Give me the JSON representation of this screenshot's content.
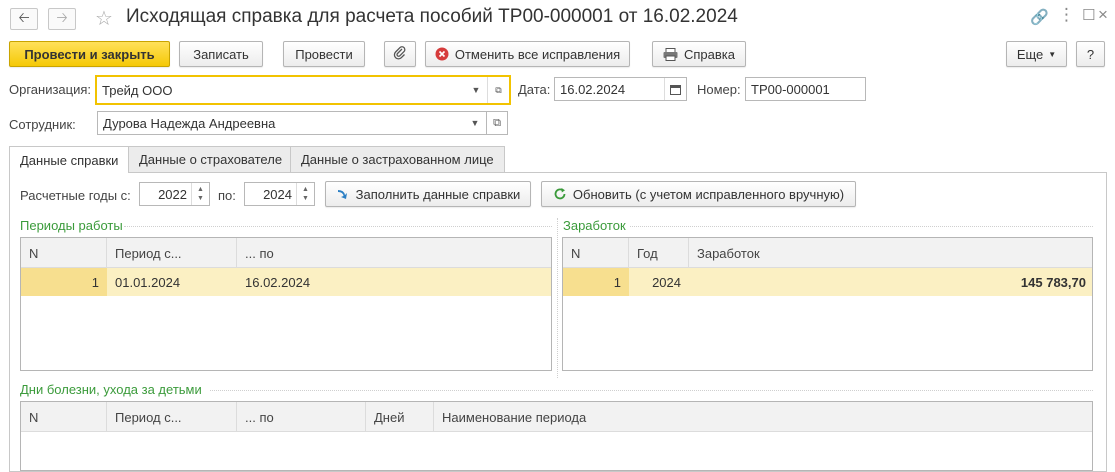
{
  "window": {
    "title": "Исходящая справка для расчета пособий ТР00-000001 от 16.02.2024"
  },
  "toolbar": {
    "post_close": "Провести и закрыть",
    "write": "Записать",
    "post": "Провести",
    "cancel_fixes": "Отменить все исправления",
    "help": "Справка",
    "more": "Еще",
    "question": "?"
  },
  "form": {
    "org_label": "Организация:",
    "org_value": "Трейд ООО",
    "date_label": "Дата:",
    "date_value": "16.02.2024",
    "number_label": "Номер:",
    "number_value": "ТР00-000001",
    "employee_label": "Сотрудник:",
    "employee_value": "Дурова Надежда Андреевна"
  },
  "tabs": [
    {
      "label": "Данные справки"
    },
    {
      "label": "Данные о страхователе"
    },
    {
      "label": "Данные о застрахованном лице"
    }
  ],
  "calc": {
    "years_from_label": "Расчетные годы с:",
    "year_from": "2022",
    "to_label": "по:",
    "year_to": "2024",
    "fill_button": "Заполнить данные справки",
    "refresh_button": "Обновить (с учетом исправленного вручную)"
  },
  "work_periods": {
    "title": "Периоды работы",
    "columns": [
      "N",
      "Период с...",
      "... по"
    ],
    "rows": [
      {
        "n": "1",
        "from": "01.01.2024",
        "to": "16.02.2024"
      }
    ]
  },
  "earnings": {
    "title": "Заработок",
    "columns": [
      "N",
      "Год",
      "Заработок"
    ],
    "rows": [
      {
        "n": "1",
        "year": "2024",
        "amount": "145 783,70"
      }
    ]
  },
  "sick_days": {
    "title": "Дни болезни, ухода за детьми",
    "columns": [
      "N",
      "Период с...",
      "... по",
      "Дней",
      "Наименование периода"
    ]
  },
  "colors": {
    "primary_button": "#f5c906",
    "group_title": "#3b9b3b",
    "selected_row": "#fbf0c3"
  }
}
